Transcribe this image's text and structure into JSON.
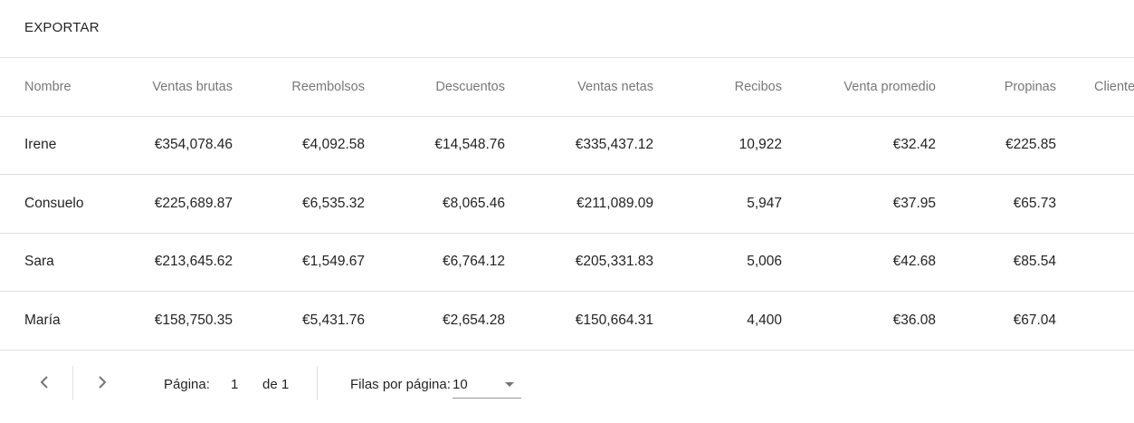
{
  "toolbar": {
    "export_label": "EXPORTAR"
  },
  "table": {
    "columns": [
      "Nombre",
      "Ventas brutas",
      "Reembolsos",
      "Descuentos",
      "Ventas netas",
      "Recibos",
      "Venta promedio",
      "Propinas",
      "Clientes"
    ],
    "rows": [
      [
        "Irene",
        "€354,078.46",
        "€4,092.58",
        "€14,548.76",
        "€335,437.12",
        "10,922",
        "€32.42",
        "€225.85",
        ""
      ],
      [
        "Consuelo",
        "€225,689.87",
        "€6,535.32",
        "€8,065.46",
        "€211,089.09",
        "5,947",
        "€37.95",
        "€65.73",
        ""
      ],
      [
        "Sara",
        "€213,645.62",
        "€1,549.67",
        "€6,764.12",
        "€205,331.83",
        "5,006",
        "€42.68",
        "€85.54",
        ""
      ],
      [
        "María",
        "€158,750.35",
        "€5,431.76",
        "€2,654.28",
        "€150,664.31",
        "4,400",
        "€36.08",
        "€67.04",
        ""
      ]
    ]
  },
  "pagination": {
    "prev_icon": "chevron-left-icon",
    "next_icon": "chevron-right-icon",
    "page_label": "Página:",
    "current_page": "1",
    "of_label": "de 1",
    "rows_per_page_label": "Filas por página:",
    "rows_per_page_value": "10"
  }
}
